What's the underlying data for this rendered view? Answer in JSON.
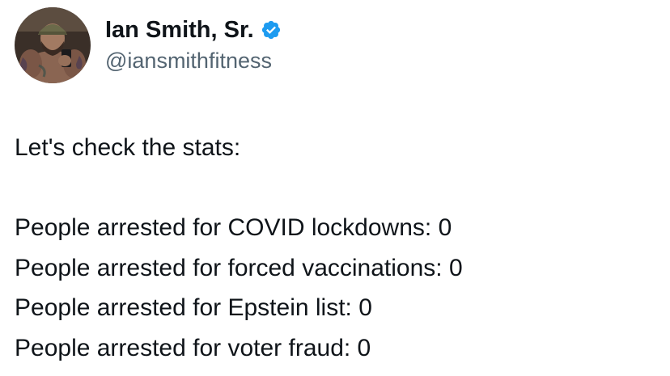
{
  "author": {
    "display_name": "Ian Smith, Sr.",
    "handle": "@iansmithfitness",
    "verified": true,
    "verified_color": "#1d9bf0",
    "avatar_icon": "profile-photo"
  },
  "tweet": {
    "intro": "Let's check the stats:",
    "lines": [
      "People arrested for COVID lockdowns: 0",
      "People arrested for forced vaccinations: 0",
      "People arrested for Epstein list: 0",
      "People arrested for voter fraud: 0"
    ]
  }
}
